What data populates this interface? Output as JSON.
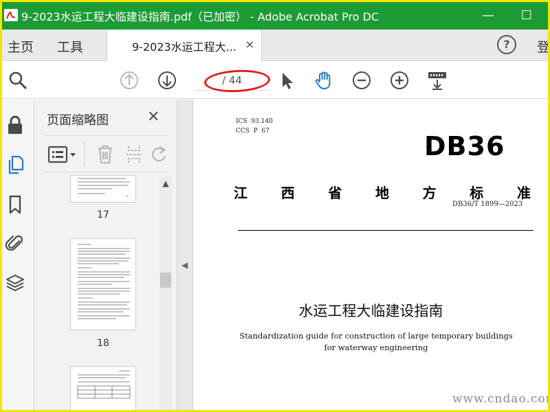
{
  "window": {
    "title": "9-2023水运工程大临建设指南.pdf（已加密） - Adobe Acrobat Pro DC",
    "minimize": "—",
    "maximize": "☐",
    "colors": {
      "titlebar": "#1d9b35",
      "frame": "#f2e600",
      "annotation": "#e31b1b"
    }
  },
  "menubar": {
    "home": "主页",
    "tools": "工具",
    "doc_tab": "9-2023水运工程大...",
    "doc_tab_close": "×",
    "help": "?",
    "login": "登"
  },
  "toolbar": {
    "icons": [
      "search-icon",
      "prev-page-icon",
      "next-page-icon",
      "select-cursor-icon",
      "hand-tool-icon",
      "zoom-out-icon",
      "zoom-in-icon",
      "fit-page-icon"
    ],
    "page_current": "",
    "page_total": "/ 44"
  },
  "rail": {
    "icons": [
      "lock-icon",
      "pages-icon",
      "bookmark-icon",
      "attachment-icon",
      "layers-icon"
    ]
  },
  "thumbnails": {
    "title": "页面缩略图",
    "close": "✕",
    "pages": [
      {
        "label": "17"
      },
      {
        "label": "18"
      },
      {
        "label": ""
      }
    ]
  },
  "document": {
    "ics": "ICS  93.140",
    "ccs": "CCS  P  67",
    "logo": "DB36",
    "province_chars": [
      "江",
      "西",
      "省",
      "地",
      "方",
      "标",
      "准"
    ],
    "std_code": "DB36/T 1899—2023",
    "title_cn": "水运工程大临建设指南",
    "title_en": "Standardization guide for construction of large temporary buildings for waterway engineering"
  },
  "watermark": "www.cndao.com"
}
